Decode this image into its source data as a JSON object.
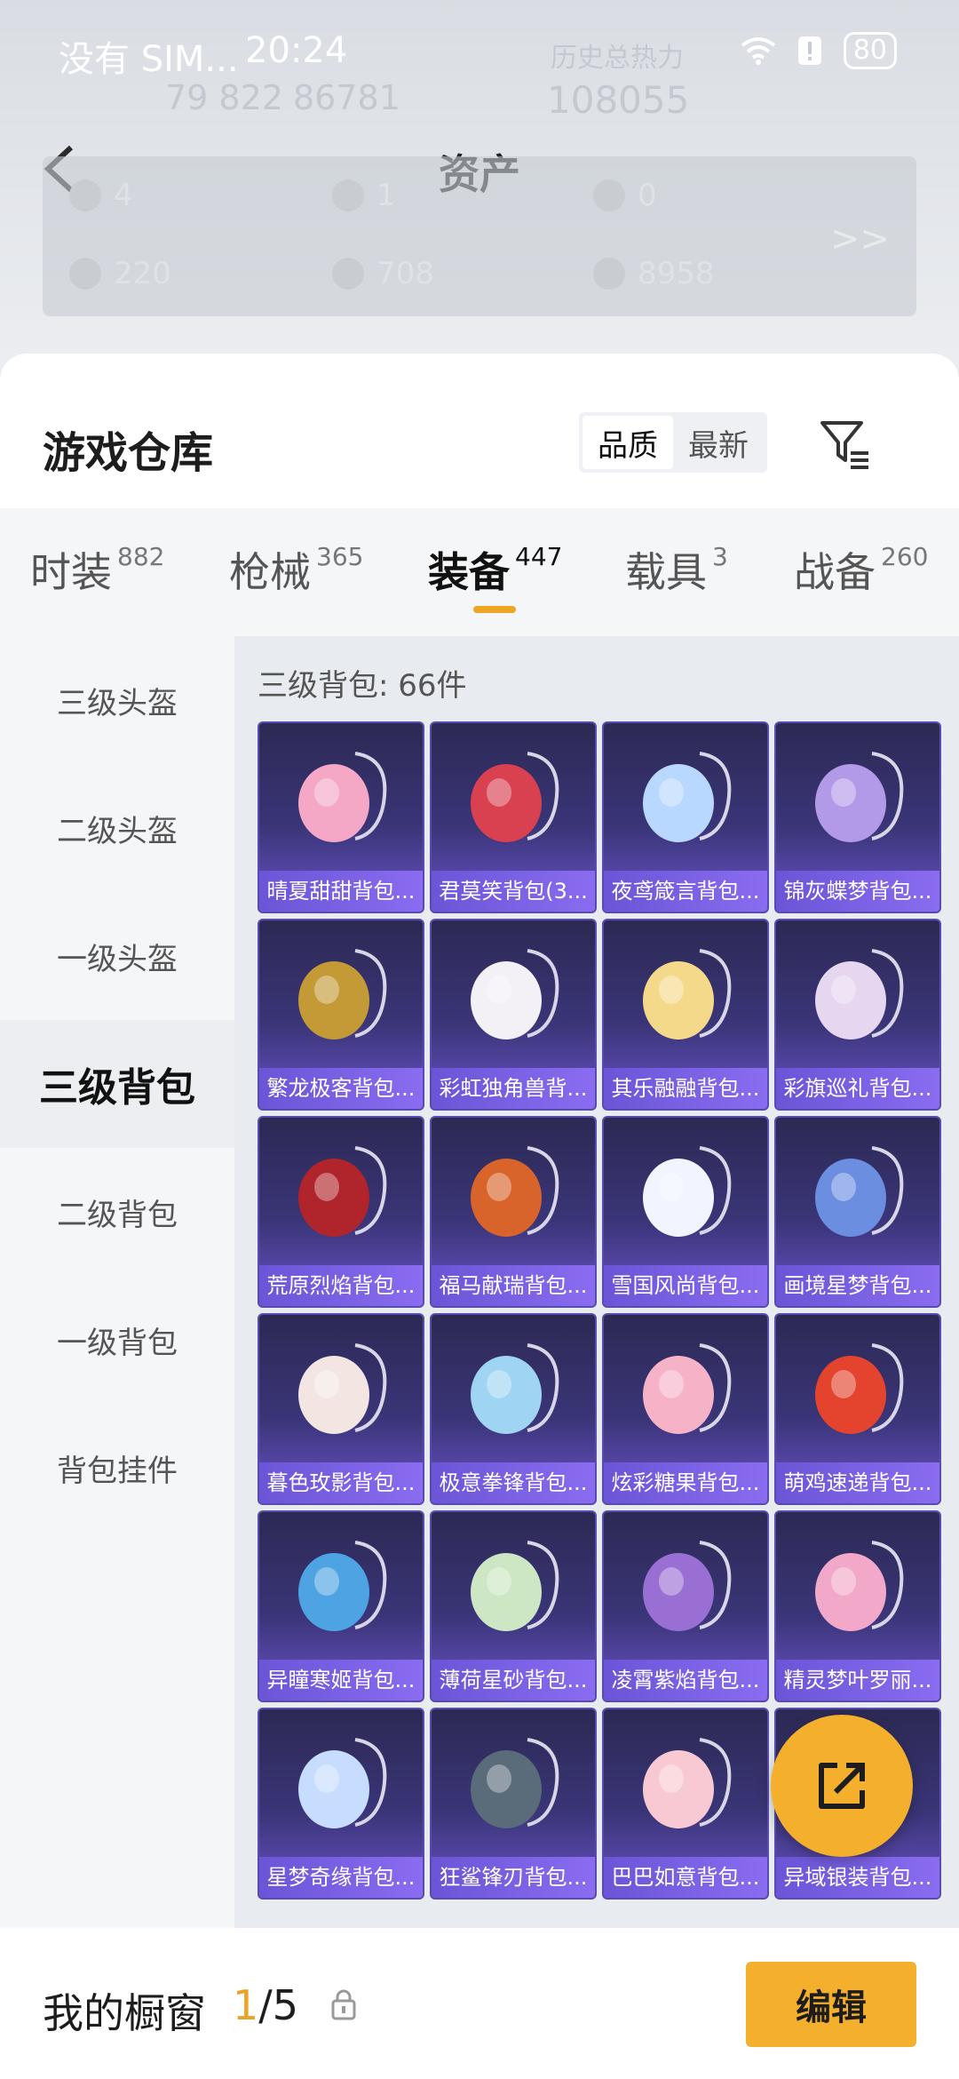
{
  "status_bar": {
    "carrier": "没有 SIM...",
    "time": "20:24",
    "battery": "80"
  },
  "header_bg": {
    "stat_a": "79 822",
    "stat_b": "86781",
    "hist_label": "历史总热力",
    "hist_value": "108055"
  },
  "nav": {
    "title": "资产"
  },
  "assets": {
    "row1": [
      "4",
      "1",
      "0"
    ],
    "row2": [
      "220",
      "708",
      "8958"
    ],
    "more": ">>"
  },
  "warehouse": {
    "title": "游戏仓库",
    "sort_options": [
      "品质",
      "最新"
    ],
    "active_sort": "品质"
  },
  "tabs": [
    {
      "label": "时装",
      "count": "882"
    },
    {
      "label": "枪械",
      "count": "365"
    },
    {
      "label": "装备",
      "count": "447"
    },
    {
      "label": "载具",
      "count": "3"
    },
    {
      "label": "战备",
      "count": "260"
    }
  ],
  "active_tab": "装备",
  "side_menu": [
    {
      "label": "三级头盔"
    },
    {
      "label": "二级头盔"
    },
    {
      "label": "一级头盔"
    },
    {
      "label": "三级背包"
    },
    {
      "label": "二级背包"
    },
    {
      "label": "一级背包"
    },
    {
      "label": "背包挂件"
    }
  ],
  "active_side": "三级背包",
  "section_label": "三级背包: 66件",
  "items": [
    {
      "name": "晴夏甜甜背包...",
      "icon": "pink-shell-backpack",
      "color": "#f4a8c6"
    },
    {
      "name": "君莫笑背包(3...",
      "icon": "winged-emblem-backpack",
      "color": "#d94050"
    },
    {
      "name": "夜鸢箴言背包...",
      "icon": "jellyfish-backpack",
      "color": "#b9d8ff"
    },
    {
      "name": "锦灰蝶梦背包...",
      "icon": "butterfly-crystal-backpack",
      "color": "#b39ae8"
    },
    {
      "name": "繁龙极客背包...",
      "icon": "gold-armor-backpack",
      "color": "#c49a36"
    },
    {
      "name": "彩虹独角兽背...",
      "icon": "unicorn-backpack",
      "color": "#f3f0f6"
    },
    {
      "name": "其乐融融背包...",
      "icon": "duck-plush-backpack",
      "color": "#f5d98a"
    },
    {
      "name": "彩旗巡礼背包...",
      "icon": "pink-gem-backpack",
      "color": "#e7d6f0"
    },
    {
      "name": "荒原烈焰背包...",
      "icon": "red-vest-backpack",
      "color": "#b0242c"
    },
    {
      "name": "福马献瑞背包...",
      "icon": "horse-plush-backpack",
      "color": "#d8642c"
    },
    {
      "name": "雪国风尚背包...",
      "icon": "snowman-backpack",
      "color": "#f2f4ff"
    },
    {
      "name": "画境星梦背包...",
      "icon": "frame-mirror-backpack",
      "color": "#6c8ee0"
    },
    {
      "name": "暮色玫影背包...",
      "icon": "doll-backpack",
      "color": "#f3e6e2"
    },
    {
      "name": "极意拳锋背包...",
      "icon": "fist-plush-backpack",
      "color": "#9fd4f2"
    },
    {
      "name": "炫彩糖果背包...",
      "icon": "donut-backpack",
      "color": "#f6b3c8"
    },
    {
      "name": "萌鸡速递背包...",
      "icon": "chick-backpack",
      "color": "#e4442e"
    },
    {
      "name": "异瞳寒姬背包...",
      "icon": "bunny-robot-backpack",
      "color": "#4ea3e2"
    },
    {
      "name": "薄荷星砂背包...",
      "icon": "mint-pouch-backpack",
      "color": "#cde6c4"
    },
    {
      "name": "凌霄紫焰背包...",
      "icon": "purple-flame-backpack",
      "color": "#9a6fd4"
    },
    {
      "name": "精灵梦叶罗丽...",
      "icon": "heart-wing-backpack",
      "color": "#f2a8c8"
    },
    {
      "name": "星梦奇缘背包...",
      "icon": "swan-backpack",
      "color": "#c6ddff"
    },
    {
      "name": "狂鲨锋刃背包...",
      "icon": "shark-backpack",
      "color": "#5a6b7a"
    },
    {
      "name": "巴巴如意背包...",
      "icon": "pink-pig-backpack",
      "color": "#f8c9d2"
    },
    {
      "name": "异域银装背包...",
      "icon": "silver-backpack",
      "color": "#c8c8d8"
    }
  ],
  "bottom": {
    "showcase_label": "我的橱窗",
    "showcase_current": "1",
    "showcase_total": "/5",
    "edit_label": "编辑"
  },
  "colors": {
    "accent": "#f4b02d",
    "tab_underline": "#f0a625",
    "card_gradient_top": "#2c2954",
    "card_gradient_bottom": "#6a52c8"
  }
}
